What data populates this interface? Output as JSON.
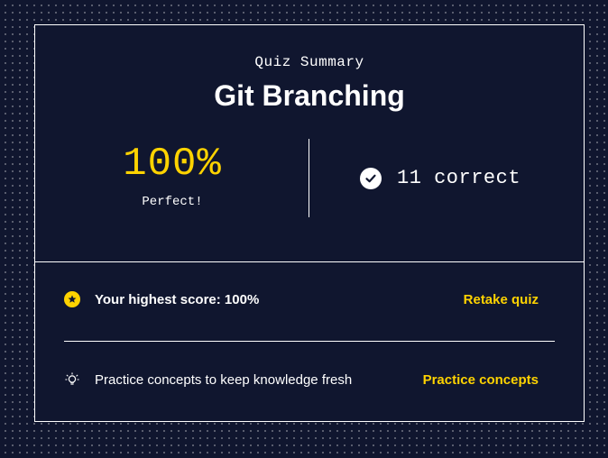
{
  "summary": {
    "subtitle": "Quiz Summary",
    "title": "Git Branching",
    "score": "100%",
    "score_label": "Perfect!",
    "correct_text": "11 correct"
  },
  "highest_score": {
    "text": "Your highest score: 100%",
    "action": "Retake quiz",
    "icon": "star-badge-icon"
  },
  "practice": {
    "text": "Practice concepts to keep knowledge fresh",
    "action": "Practice concepts",
    "icon": "lightbulb-icon"
  },
  "colors": {
    "background": "#10162f",
    "accent": "#ffd300",
    "text": "#ffffff"
  }
}
